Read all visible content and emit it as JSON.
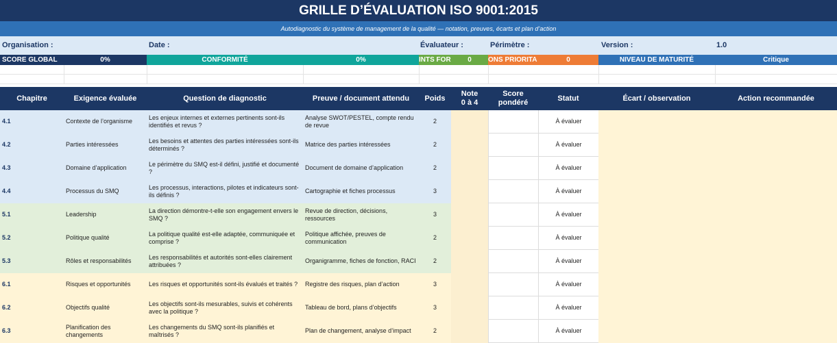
{
  "header": {
    "title": "GRILLE D’ÉVALUATION ISO 9001:2015",
    "subtitle": "Autodiagnostic du système de management de la qualité — notation, preuves, écarts et plan d’action"
  },
  "meta": {
    "organisation": "Organisation :",
    "date": "Date :",
    "evaluateur": "Évaluateur :",
    "perimetre": "Périmètre :",
    "version_label": "Version :",
    "version_value": "1.0"
  },
  "scores": {
    "global_label": "SCORE GLOBAL",
    "global_value": "0%",
    "conformite_label": "CONFORMITÉ",
    "conformite_value": "0%",
    "points_forts_label": "INTS FOR",
    "points_forts_value": "0",
    "actions_label": "ONS PRIORITA",
    "actions_value": "0",
    "maturite_label": "NIVEAU DE MATURITÉ",
    "maturite_value": "Critique"
  },
  "colors": {
    "navy": "#1c3764",
    "blue": "#2f71b6",
    "teal": "#10a59b",
    "green": "#6aaa45",
    "orange": "#ee7c36",
    "band_blue": "#dce9f6",
    "band_green": "#e2efda",
    "band_yellow": "#fff4d6"
  },
  "table": {
    "headers": {
      "chapitre": "Chapitre",
      "exigence": "Exigence évaluée",
      "question": "Question de diagnostic",
      "preuve": "Preuve / document attendu",
      "poids": "Poids",
      "note_line1": "Note",
      "note_line2": "0 à 4",
      "score_line1": "Score",
      "score_line2": "pondéré",
      "statut": "Statut",
      "ecart": "Écart / observation",
      "action": "Action recommandée"
    },
    "rows": [
      {
        "chapitre": "4.1",
        "exigence": "Contexte de l’organisme",
        "question": "Les enjeux internes et externes pertinents sont-ils identifiés et revus ?",
        "preuve": "Analyse SWOT/PESTEL, compte rendu de revue",
        "poids": "2",
        "statut": "À évaluer",
        "band": "blue"
      },
      {
        "chapitre": "4.2",
        "exigence": "Parties intéressées",
        "question": "Les besoins et attentes des parties intéressées sont-ils déterminés ?",
        "preuve": "Matrice des parties intéressées",
        "poids": "2",
        "statut": "À évaluer",
        "band": "blue"
      },
      {
        "chapitre": "4.3",
        "exigence": "Domaine d’application",
        "question": "Le périmètre du SMQ est-il défini, justifié et documenté ?",
        "preuve": "Document de domaine d’application",
        "poids": "2",
        "statut": "À évaluer",
        "band": "blue"
      },
      {
        "chapitre": "4.4",
        "exigence": "Processus du SMQ",
        "question": "Les processus, interactions, pilotes et indicateurs sont-ils définis ?",
        "preuve": "Cartographie et fiches processus",
        "poids": "3",
        "statut": "À évaluer",
        "band": "blue"
      },
      {
        "chapitre": "5.1",
        "exigence": "Leadership",
        "question": "La direction démontre-t-elle son engagement envers le SMQ ?",
        "preuve": "Revue de direction, décisions, ressources",
        "poids": "3",
        "statut": "À évaluer",
        "band": "green"
      },
      {
        "chapitre": "5.2",
        "exigence": "Politique qualité",
        "question": "La politique qualité est-elle adaptée, communiquée et comprise ?",
        "preuve": "Politique affichée, preuves de communication",
        "poids": "2",
        "statut": "À évaluer",
        "band": "green"
      },
      {
        "chapitre": "5.3",
        "exigence": "Rôles et responsabilités",
        "question": "Les responsabilités et autorités sont-elles clairement attribuées ?",
        "preuve": "Organigramme, fiches de fonction, RACI",
        "poids": "2",
        "statut": "À évaluer",
        "band": "green"
      },
      {
        "chapitre": "6.1",
        "exigence": "Risques et opportunités",
        "question": "Les risques et opportunités sont-ils évalués et traités ?",
        "preuve": "Registre des risques, plan d’action",
        "poids": "3",
        "statut": "À évaluer",
        "band": "yellow"
      },
      {
        "chapitre": "6.2",
        "exigence": "Objectifs qualité",
        "question": "Les objectifs sont-ils mesurables, suivis et cohérents avec la politique ?",
        "preuve": "Tableau de bord, plans d’objectifs",
        "poids": "3",
        "statut": "À évaluer",
        "band": "yellow"
      },
      {
        "chapitre": "6.3",
        "exigence": "Planification des changements",
        "question": "Les changements du SMQ sont-ils planifiés et maîtrisés ?",
        "preuve": "Plan de changement, analyse d’impact",
        "poids": "2",
        "statut": "À évaluer",
        "band": "yellow"
      }
    ]
  }
}
